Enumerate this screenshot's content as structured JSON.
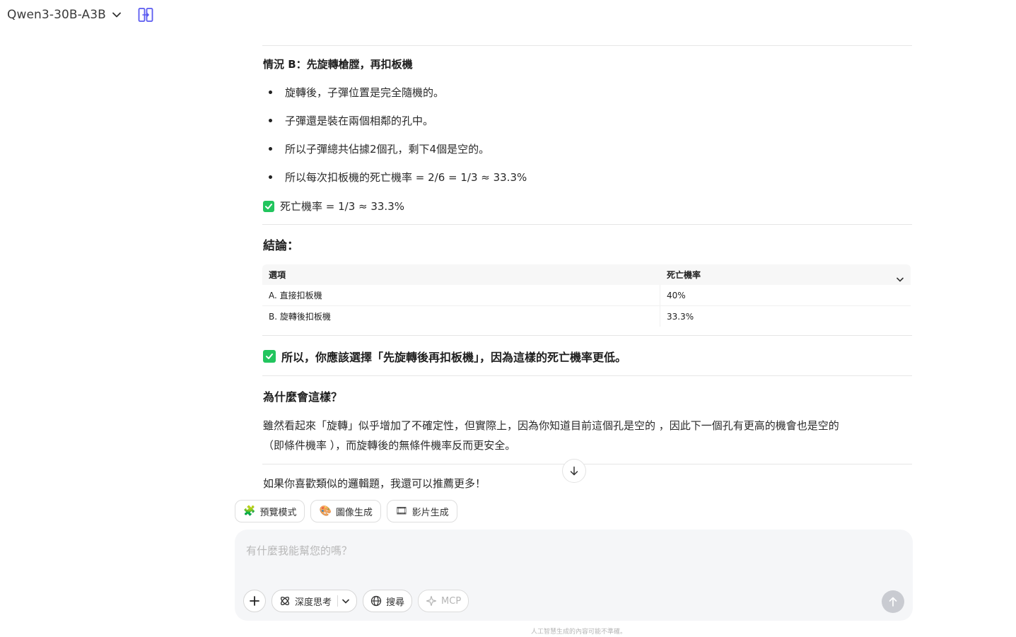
{
  "header": {
    "model_name": "Qwen3-30B-A3B"
  },
  "message": {
    "case_b_heading": "情況 B：先旋轉槍膛，再扣板機",
    "case_b_bullets": [
      "旋轉後，子彈位置是完全隨機的。",
      "子彈還是裝在兩個相鄰的孔中。",
      "所以子彈總共佔據2個孔，剩下4個是空的。",
      "所以每次扣板機的死亡機率 = 2/6 = 1/3 ≈ 33.3%"
    ],
    "case_b_result": "死亡機率 = 1/3 ≈ 33.3%",
    "conclusion_heading": "結論：",
    "table": {
      "headers": [
        "選項",
        "死亡機率"
      ],
      "rows": [
        [
          "A. 直接扣板機",
          "40%"
        ],
        [
          "B. 旋轉後扣板機",
          "33.3%"
        ]
      ]
    },
    "final_answer": "所以，你應該選擇「先旋轉後再扣板機」，因為這樣的死亡機率更低。",
    "why_heading": "為什麼會這樣？",
    "why_paragraph_line1": "雖然看起來「旋轉」似乎增加了不確定性，但實際上，因為你知道目前這個孔是空的 ，因此下一個孔有更高的機會也是空的",
    "why_paragraph_line2": "（即條件機率 ），而旋轉後的無條件機率反而更安全。",
    "closing": "如果你喜歡類似的邏輯題，我還可以推薦更多！"
  },
  "chips": [
    {
      "emoji": "🧩",
      "label": "預覽模式"
    },
    {
      "emoji": "🎨",
      "label": "圖像生成"
    },
    {
      "emoji": "🎞",
      "label": "影片生成"
    }
  ],
  "composer": {
    "placeholder": "有什麼我能幫您的嗎？",
    "deep_think_label": "深度思考",
    "search_label": "搜尋",
    "mcp_label": "MCP"
  },
  "footer": {
    "disclaimer": "人工智慧生成的內容可能不準確。"
  },
  "colors": {
    "accent_icon": "#5b5bf0",
    "check_green": "#22c55e",
    "send_disabled": "#c9cbd1"
  }
}
